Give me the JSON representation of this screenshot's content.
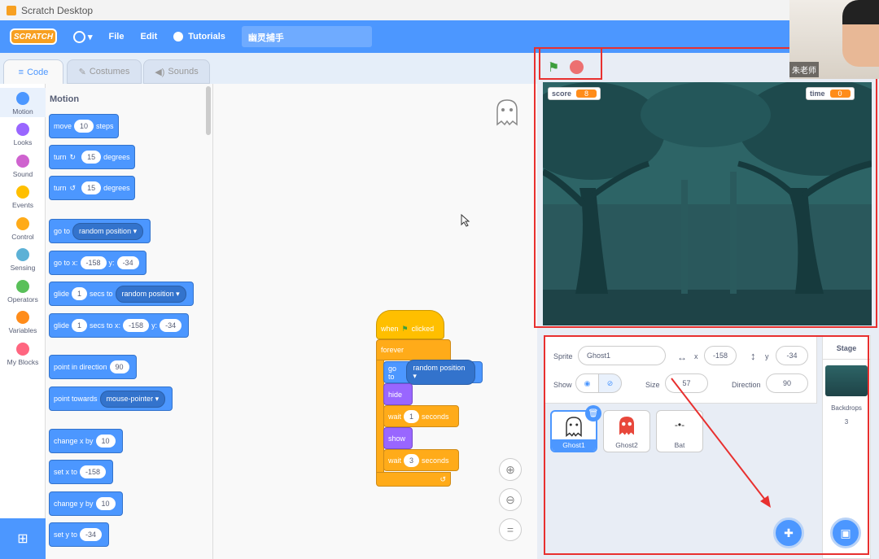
{
  "window": {
    "title": "Scratch Desktop"
  },
  "menu": {
    "file": "File",
    "edit": "Edit",
    "tutorials": "Tutorials",
    "project_name": "幽灵捕手",
    "logo": "SCRATCH"
  },
  "tabs": {
    "code": "Code",
    "costumes": "Costumes",
    "sounds": "Sounds"
  },
  "categories": [
    "Motion",
    "Looks",
    "Sound",
    "Events",
    "Control",
    "Sensing",
    "Operators",
    "Variables",
    "My Blocks"
  ],
  "category_colors": [
    "#4c97ff",
    "#9966ff",
    "#cf63cf",
    "#ffbf00",
    "#ffab19",
    "#5cb1d6",
    "#59c059",
    "#ff8c1a",
    "#ff6680"
  ],
  "palette": {
    "title": "Motion",
    "move": "move",
    "move_val": "10",
    "steps": "steps",
    "turn": "turn",
    "turn_r_val": "15",
    "turn_l_val": "15",
    "degrees": "degrees",
    "goto": "go to",
    "random_position": "random position",
    "goto_x": "go to x:",
    "x_val": "-158",
    "y_label": "y:",
    "y_val": "-34",
    "glide": "glide",
    "glide_val": "1",
    "secs_to": "secs to",
    "secs_to_x": "secs to x:",
    "point_dir": "point in direction",
    "dir_val": "90",
    "point_towards": "point towards",
    "mouse_pointer": "mouse-pointer",
    "change_x": "change x by",
    "change_x_val": "10",
    "set_x": "set x to",
    "set_x_val": "-158",
    "change_y": "change y by",
    "change_y_val": "10",
    "set_y": "set y to",
    "set_y_val": "-34"
  },
  "script": {
    "when": "when",
    "clicked": "clicked",
    "forever": "forever",
    "goto": "go to",
    "random_position": "random position",
    "hide": "hide",
    "wait": "wait",
    "wait1": "1",
    "seconds": "seconds",
    "show": "show",
    "wait2": "3"
  },
  "monitors": {
    "score_label": "score",
    "score_val": "8",
    "time_label": "time",
    "time_val": "0"
  },
  "sprite_info": {
    "sprite_label": "Sprite",
    "sprite_name": "Ghost1",
    "x_label": "x",
    "x_val": "-158",
    "y_label": "y",
    "y_val": "-34",
    "show_label": "Show",
    "size_label": "Size",
    "size_val": "57",
    "direction_label": "Direction",
    "direction_val": "90"
  },
  "sprites": [
    "Ghost1",
    "Ghost2",
    "Bat"
  ],
  "stage_pane": {
    "title": "Stage",
    "backdrops_label": "Backdrops",
    "backdrops_count": "3"
  },
  "webcam": {
    "name": "朱老师"
  }
}
